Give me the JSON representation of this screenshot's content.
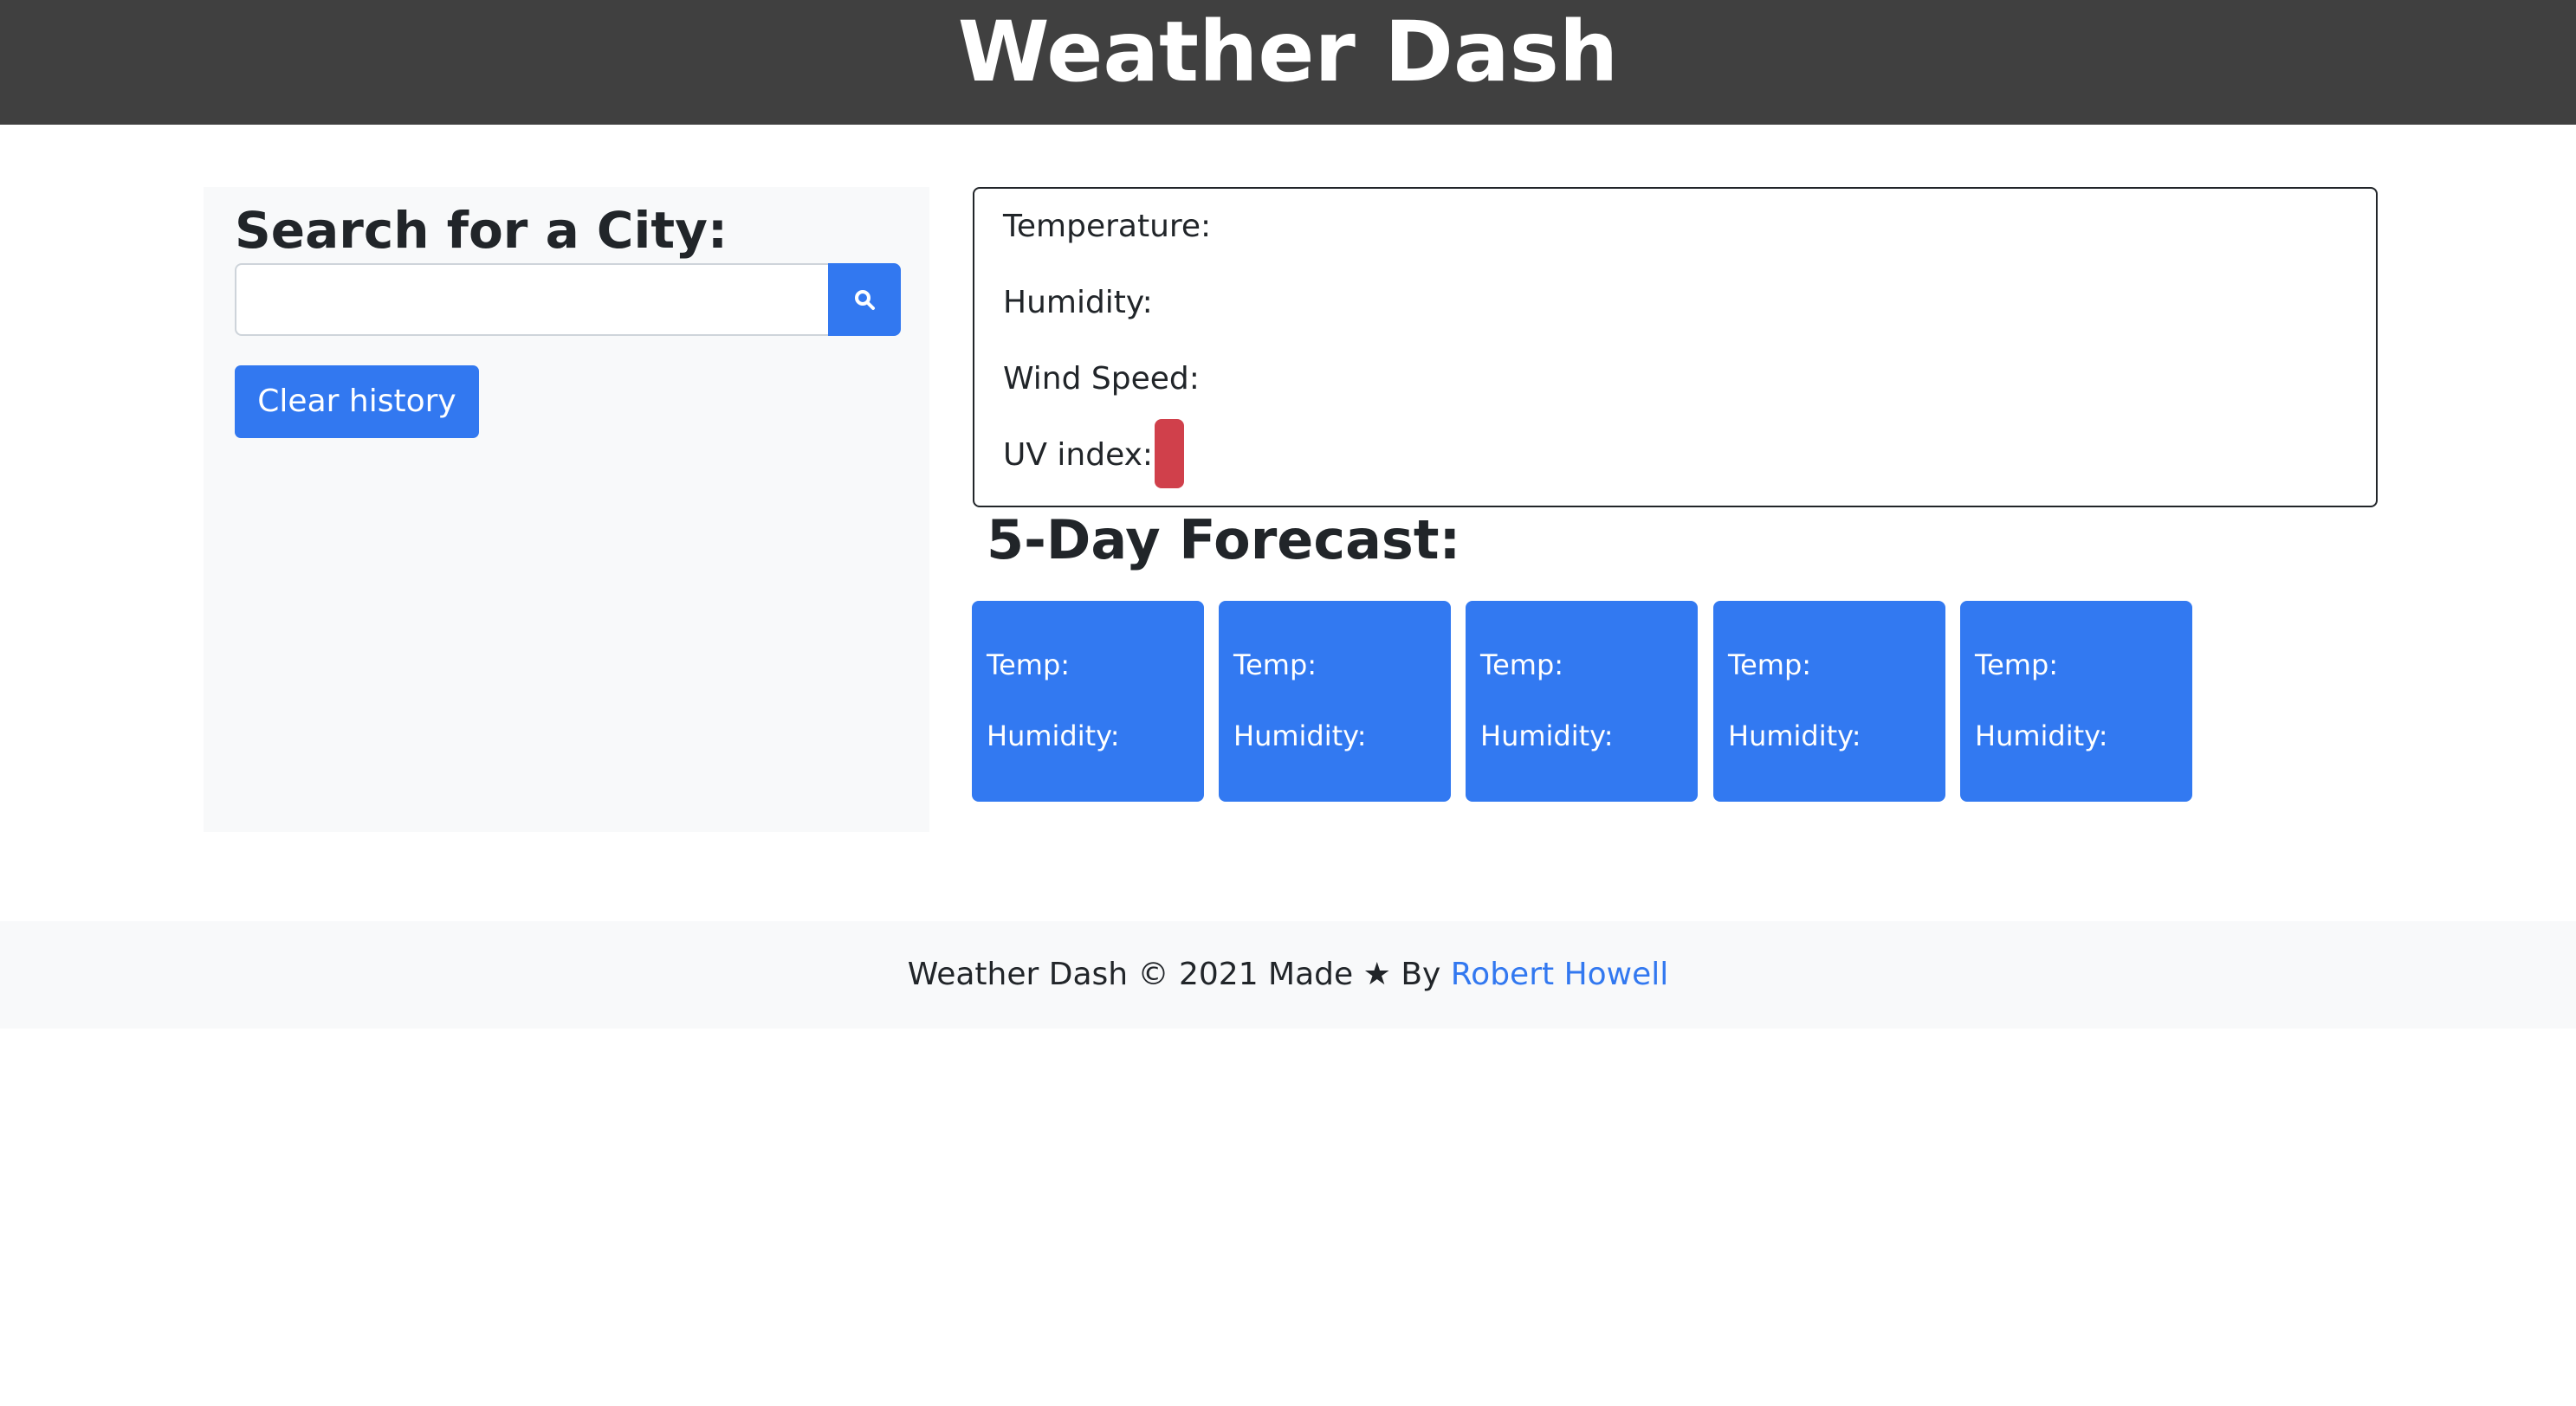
{
  "header": {
    "title": "Weather Dash"
  },
  "search": {
    "title": "Search for a City:",
    "value": "",
    "placeholder": "",
    "clear_label": "Clear history",
    "button_icon": "search-icon"
  },
  "current": {
    "temperature_label": "Temperature:",
    "humidity_label": "Humidity:",
    "wind_label": "Wind Speed:",
    "uv_label": "UV index:",
    "uv_color": "#d0404b"
  },
  "forecast": {
    "title": "5-Day Forecast:",
    "cards": [
      {
        "temp_label": "Temp:",
        "humidity_label": "Humidity:"
      },
      {
        "temp_label": "Temp:",
        "humidity_label": "Humidity:"
      },
      {
        "temp_label": "Temp:",
        "humidity_label": "Humidity:"
      },
      {
        "temp_label": "Temp:",
        "humidity_label": "Humidity:"
      },
      {
        "temp_label": "Temp:",
        "humidity_label": "Humidity:"
      }
    ]
  },
  "footer": {
    "text": "Weather Dash © 2021 Made ★ By ",
    "author": "Robert Howell"
  },
  "colors": {
    "header_bg": "#404040",
    "accent": "#3278f0",
    "panel_bg": "#f8f9fa",
    "uv_high": "#d0404b"
  }
}
